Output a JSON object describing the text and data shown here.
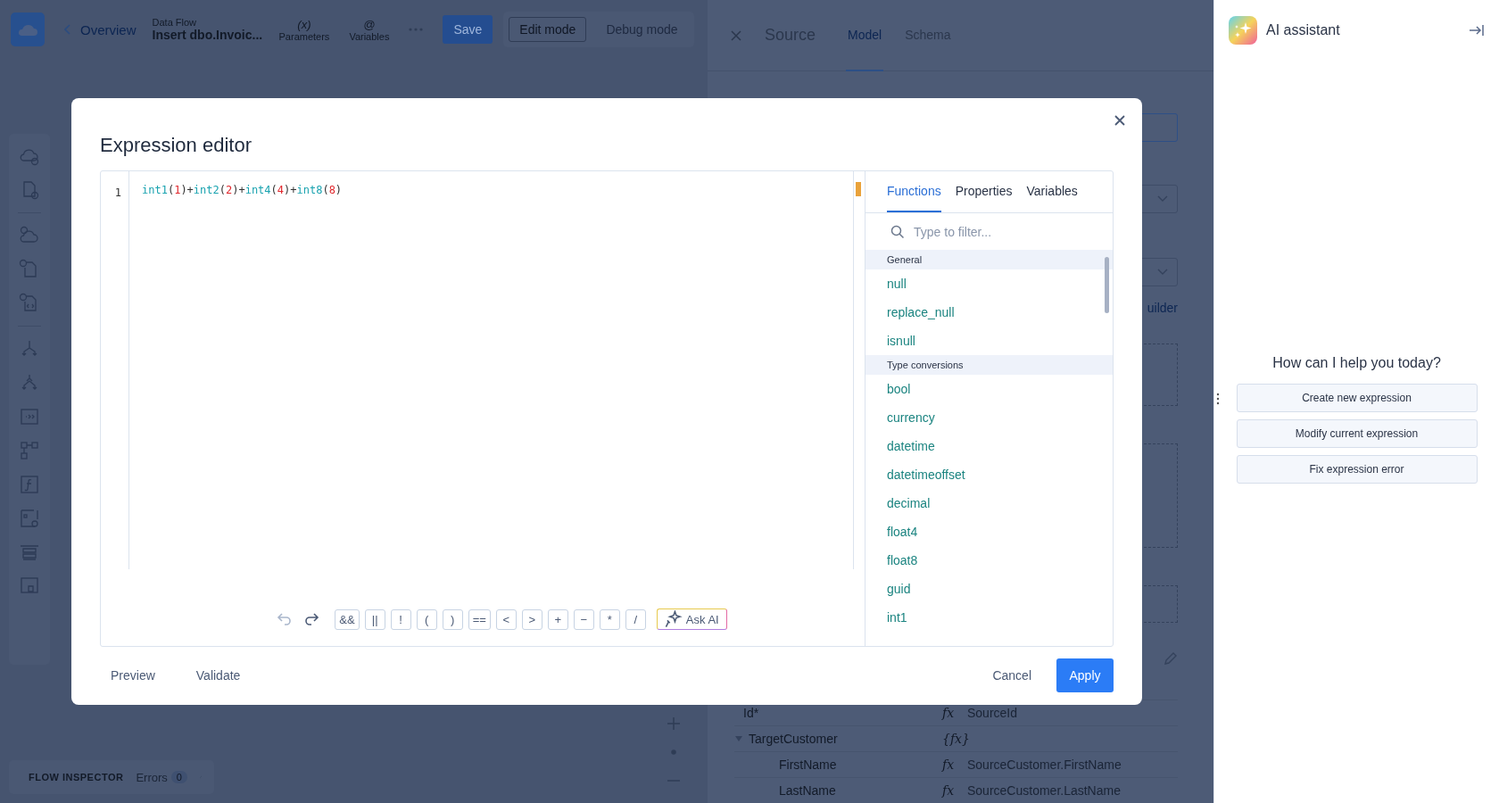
{
  "topbar": {
    "back_link": "Overview",
    "flow_label": "Data Flow",
    "flow_name": "Insert dbo.Invoic...",
    "tools": [
      {
        "symbol": "(x)",
        "label": "Parameters"
      },
      {
        "symbol": "@",
        "label": "Variables"
      }
    ],
    "save": "Save",
    "modes": [
      {
        "label": "Edit mode",
        "selected": true
      },
      {
        "label": "Debug mode",
        "selected": false
      }
    ]
  },
  "flow_inspector": {
    "title": "FLOW INSPECTOR",
    "errors_label": "Errors",
    "errors_count": "0"
  },
  "source_panel": {
    "title": "Source",
    "tabs": [
      {
        "label": "Model",
        "selected": true
      },
      {
        "label": "Schema",
        "selected": false
      }
    ],
    "link": "uilder",
    "rows": [
      {
        "name": "Id*",
        "expr": "fx",
        "value": "SourceId"
      },
      {
        "name": "TargetCustomer",
        "expr": "{fx}",
        "expanded": true,
        "children": [
          {
            "name": "FirstName",
            "expr": "fx",
            "value": "SourceCustomer.FirstName"
          },
          {
            "name": "LastName",
            "expr": "fx",
            "value": "SourceCustomer.LastName"
          }
        ]
      }
    ]
  },
  "modal": {
    "title": "Expression editor",
    "line_number": "1",
    "tokens": [
      {
        "text": "int1",
        "kind": "fn"
      },
      {
        "text": "(",
        "kind": "punct"
      },
      {
        "text": "1",
        "kind": "num"
      },
      {
        "text": ")+",
        "kind": "punct"
      },
      {
        "text": "int2",
        "kind": "fn"
      },
      {
        "text": "(",
        "kind": "punct"
      },
      {
        "text": "2",
        "kind": "num"
      },
      {
        "text": ")+",
        "kind": "punct"
      },
      {
        "text": "int4",
        "kind": "fn"
      },
      {
        "text": "(",
        "kind": "punct"
      },
      {
        "text": "4",
        "kind": "num"
      },
      {
        "text": ")+",
        "kind": "punct"
      },
      {
        "text": "int8",
        "kind": "fn"
      },
      {
        "text": "(",
        "kind": "punct"
      },
      {
        "text": "8",
        "kind": "num"
      },
      {
        "text": ")",
        "kind": "punct"
      }
    ],
    "operators": [
      "&&",
      "||",
      "!",
      "(",
      ")",
      "==",
      "<",
      ">",
      "+",
      "−",
      "*",
      "/"
    ],
    "ask_ai": "Ask AI",
    "tabs": [
      {
        "label": "Functions",
        "selected": true
      },
      {
        "label": "Properties",
        "selected": false
      },
      {
        "label": "Variables",
        "selected": false
      }
    ],
    "filter_placeholder": "Type to filter...",
    "groups": [
      {
        "title": "General",
        "items": [
          "null",
          "replace_null",
          "isnull"
        ]
      },
      {
        "title": "Type conversions",
        "items": [
          "bool",
          "currency",
          "datetime",
          "datetimeoffset",
          "decimal",
          "float4",
          "float8",
          "guid",
          "int1"
        ]
      }
    ],
    "footer_links": [
      "Preview",
      "Validate"
    ],
    "cancel": "Cancel",
    "apply": "Apply"
  },
  "ai_panel": {
    "title": "AI assistant",
    "prompt": "How can I help you today?",
    "suggestions": [
      "Create new expression",
      "Modify current expression",
      "Fix expression error"
    ]
  }
}
